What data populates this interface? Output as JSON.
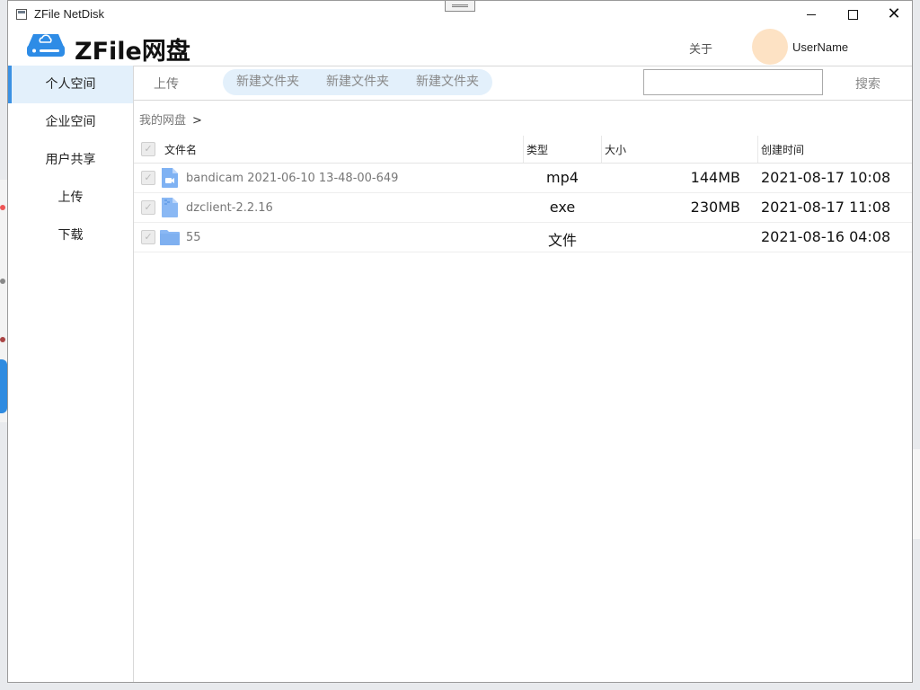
{
  "window": {
    "title": "ZFile NetDisk",
    "icons": {
      "minimize": "minimize-icon",
      "maximize": "maximize-icon",
      "close": "close-icon"
    }
  },
  "header": {
    "logo_icon": "cloud-drive-icon",
    "logo_text": "ZFile网盘",
    "about_label": "关于",
    "username": "UserName",
    "avatar_color": "#fde2c4"
  },
  "sidebar": {
    "items": [
      {
        "label": "个人空间",
        "active": true
      },
      {
        "label": "企业空间",
        "active": false
      },
      {
        "label": "用户共享",
        "active": false
      },
      {
        "label": "上传",
        "active": false
      },
      {
        "label": "下载",
        "active": false
      }
    ]
  },
  "toolbar": {
    "upload_label": "上传",
    "new_folder_buttons": [
      "新建文件夹",
      "新建文件夹",
      "新建文件夹"
    ],
    "search_value": "",
    "search_button": "搜索"
  },
  "breadcrumb": {
    "root": "我的网盘",
    "separator": ">"
  },
  "table": {
    "columns": {
      "name": "文件名",
      "type": "类型",
      "size": "大小",
      "created": "创建时间"
    },
    "rows": [
      {
        "icon": "video-file-icon",
        "name": "bandicam 2021-06-10 13-48-00-649",
        "type": "mp4",
        "size": "144MB",
        "created": "2021-08-17 10:08"
      },
      {
        "icon": "file-icon",
        "name": "dzclient-2.2.16",
        "type": "exe",
        "size": "230MB",
        "created": "2021-08-17 11:08"
      },
      {
        "icon": "folder-icon",
        "name": "55",
        "type": "文件",
        "size": "",
        "created": "2021-08-16 04:08"
      }
    ]
  },
  "colors": {
    "accent": "#3b91e3",
    "active_bg": "#e3f0fb",
    "icon_blue": "#8ab8f4"
  }
}
